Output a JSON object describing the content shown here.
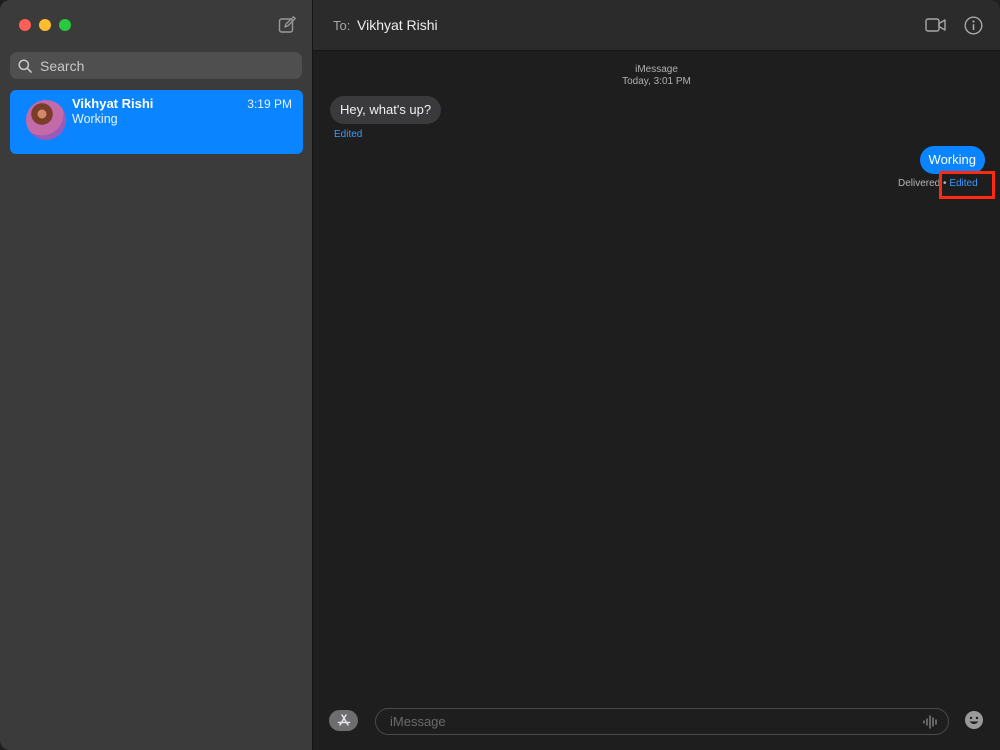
{
  "sidebar": {
    "search_placeholder": "Search",
    "conversations": [
      {
        "name": "Vikhyat Rishi",
        "time": "3:19 PM",
        "preview": "Working"
      }
    ]
  },
  "header": {
    "to_label": "To:",
    "recipient": "Vikhyat Rishi"
  },
  "thread": {
    "service": "iMessage",
    "timestamp": "Today, 3:01 PM",
    "messages": [
      {
        "direction": "incoming",
        "text": "Hey, what's up?",
        "edited_label": "Edited"
      },
      {
        "direction": "outgoing",
        "text": "Working",
        "status": "Delivered",
        "separator": "•",
        "edited_label": "Edited"
      }
    ]
  },
  "composer": {
    "placeholder": "iMessage"
  },
  "colors": {
    "accent": "#0a84ff",
    "highlight": "#ff2a12",
    "traffic_close": "#ff5f57",
    "traffic_min": "#febc2e",
    "traffic_max": "#28c840"
  },
  "icons": [
    "compose-icon",
    "search-icon",
    "video-icon",
    "info-icon",
    "app-store-icon",
    "waveform-icon",
    "emoji-icon"
  ]
}
